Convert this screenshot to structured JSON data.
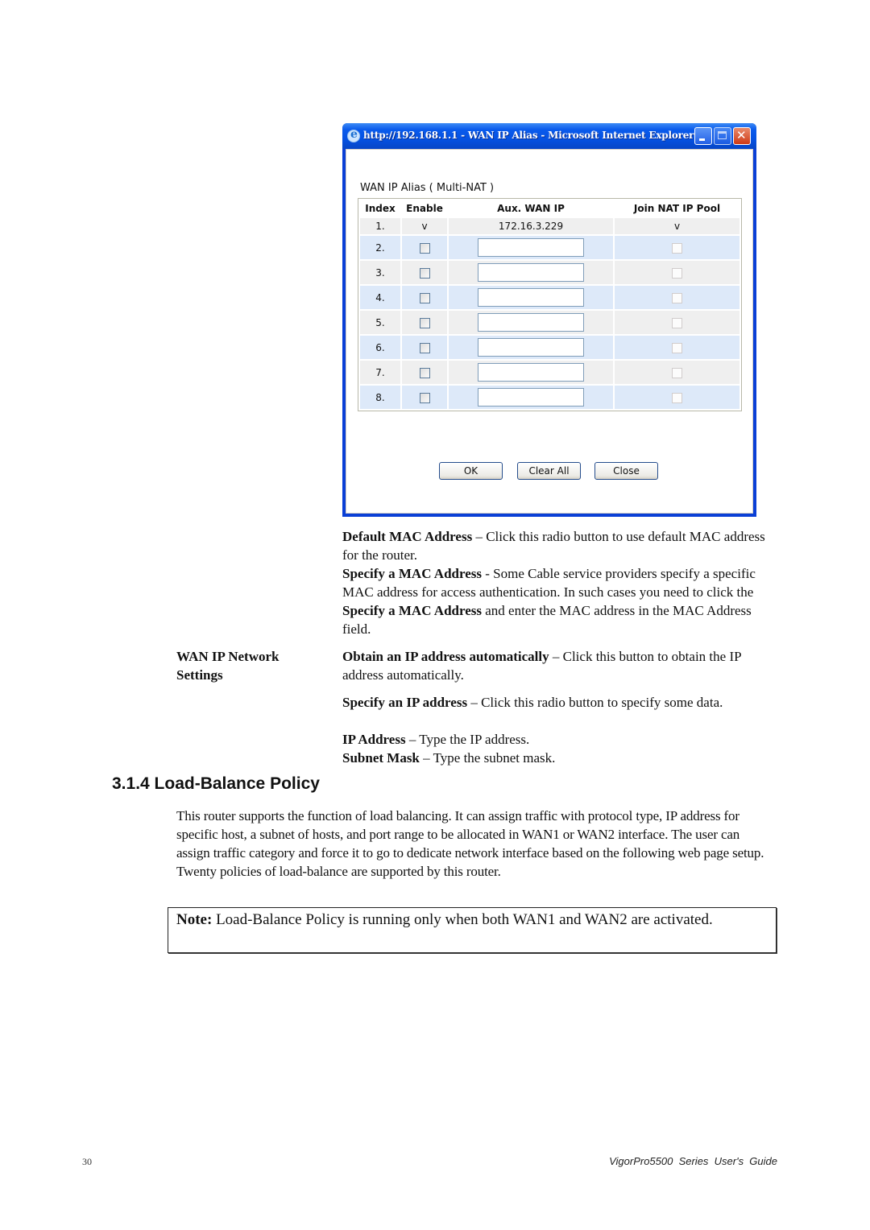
{
  "window": {
    "title": "http://192.168.1.1 - WAN IP Alias - Microsoft Internet Explorer",
    "icon": "ie-icon",
    "controls": {
      "minimize": "minimize-icon",
      "maximize": "maximize-icon",
      "close": "close-icon"
    }
  },
  "alias": {
    "title": "WAN IP Alias ( Multi-NAT )",
    "columns": [
      "Index",
      "Enable",
      "Aux. WAN IP",
      "Join NAT IP Pool"
    ],
    "rows": [
      {
        "index": "1.",
        "enable": "v",
        "ip": "172.16.3.229",
        "join": "v",
        "editable": false
      },
      {
        "index": "2.",
        "enable": false,
        "ip": "",
        "join": false,
        "editable": true
      },
      {
        "index": "3.",
        "enable": false,
        "ip": "",
        "join": false,
        "editable": true
      },
      {
        "index": "4.",
        "enable": false,
        "ip": "",
        "join": false,
        "editable": true
      },
      {
        "index": "5.",
        "enable": false,
        "ip": "",
        "join": false,
        "editable": true
      },
      {
        "index": "6.",
        "enable": false,
        "ip": "",
        "join": false,
        "editable": true
      },
      {
        "index": "7.",
        "enable": false,
        "ip": "",
        "join": false,
        "editable": true
      },
      {
        "index": "8.",
        "enable": false,
        "ip": "",
        "join": false,
        "editable": true
      }
    ],
    "buttons": {
      "ok": "OK",
      "clear_all": "Clear All",
      "close": "Close"
    }
  },
  "doc": {
    "default_mac": {
      "term": "Default MAC Address",
      "text": " – Click this radio button to use default MAC address for the router."
    },
    "specify_mac": {
      "term": "Specify a MAC Address",
      "text1": " - Some Cable service providers specify a specific MAC address for access authentication. In such cases you need to click the ",
      "term2": "Specify a MAC Address",
      "text2": " and enter the MAC address in the MAC Address field."
    },
    "wan_ip_label": "WAN IP Network Settings",
    "obtain": {
      "term": "Obtain an IP address automatically",
      "text": " – Click this button to obtain the IP address automatically."
    },
    "specify_ip": {
      "term": "Specify an IP address",
      "text": " – Click this radio button to specify some data."
    },
    "ip_address": {
      "term": "IP Address",
      "text": " – Type the IP address."
    },
    "subnet_mask": {
      "term": "Subnet Mask",
      "text": " – Type the subnet mask."
    },
    "section_heading": "3.1.4 Load-Balance Policy",
    "section_body": "This router supports the function of load balancing. It can assign traffic with protocol type, IP address for specific host, a subnet of hosts, and port range to be allocated in WAN1 or WAN2 interface. The user can assign traffic category and force it to go to dedicate network interface based on the following web page setup. Twenty policies of load-balance are supported by this router.",
    "note": {
      "label": "Note:",
      "text": " Load-Balance Policy is running only when both WAN1 and WAN2 are activated."
    }
  },
  "footer": {
    "page_number": "30",
    "guide_title": "VigorPro5500  Series  User's  Guide"
  }
}
